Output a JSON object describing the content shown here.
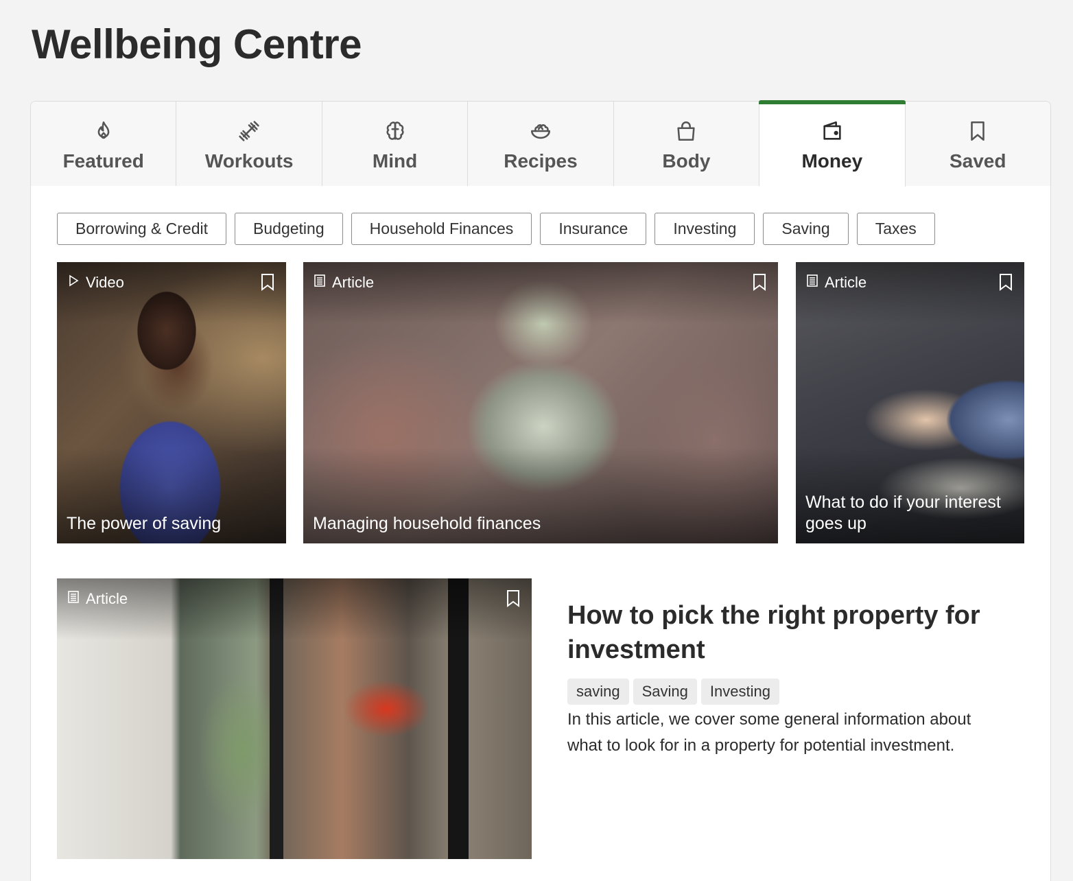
{
  "page": {
    "title": "Wellbeing Centre"
  },
  "tabs": [
    {
      "label": "Featured",
      "icon": "flame-icon"
    },
    {
      "label": "Workouts",
      "icon": "dumbbell-icon"
    },
    {
      "label": "Mind",
      "icon": "brain-icon"
    },
    {
      "label": "Recipes",
      "icon": "salad-bowl-icon"
    },
    {
      "label": "Body",
      "icon": "shopping-bag-icon"
    },
    {
      "label": "Money",
      "icon": "wallet-icon",
      "active": true
    },
    {
      "label": "Saved",
      "icon": "bookmark-icon"
    }
  ],
  "accent_color": "#2e7d32",
  "filters": [
    "Borrowing & Credit",
    "Budgeting",
    "Household Finances",
    "Insurance",
    "Investing",
    "Saving",
    "Taxes"
  ],
  "cards": [
    {
      "type": "Video",
      "type_icon": "play-icon",
      "title": "The power of saving"
    },
    {
      "type": "Article",
      "type_icon": "article-icon",
      "title": "Managing household finances"
    },
    {
      "type": "Article",
      "type_icon": "article-icon",
      "title": "What to do if your interest goes up"
    }
  ],
  "feature": {
    "type": "Article",
    "type_icon": "article-icon",
    "title": "How to pick the right property for investment",
    "tags": [
      "saving",
      "Saving",
      "Investing"
    ],
    "description": "In this article, we cover some general information about what to look for in a property for potential investment."
  }
}
